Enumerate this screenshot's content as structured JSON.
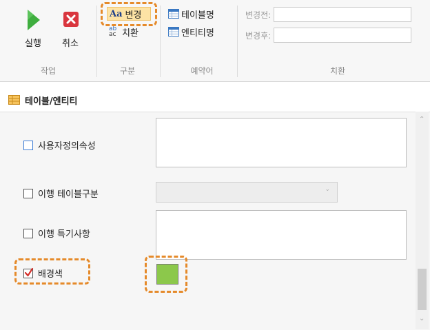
{
  "ribbon": {
    "run_label": "실행",
    "cancel_label": "취소",
    "change_label": "변경",
    "replace_label": "치환",
    "table_name_label": "테이블명",
    "entity_name_label": "엔티티명",
    "before_label": "변경전:",
    "after_label": "변경후:",
    "before_value": "",
    "after_value": "",
    "groups": {
      "work": "작업",
      "category": "구분",
      "reserved": "예약어",
      "replace": "치환"
    }
  },
  "panel": {
    "title": "테이블/엔티티",
    "properties": {
      "user_defined": "사용자정의속성",
      "migration_table_type": "이행 테이블구분",
      "migration_notes": "이행 특기사항",
      "background_color": "배경색"
    },
    "background_color_checked": true,
    "background_color_value": "#8cc84b"
  },
  "colors": {
    "highlight": "#e58a2a",
    "run_icon": "#3fae3f",
    "cancel_icon": "#d9363e"
  },
  "icons": {
    "run": "play-icon",
    "cancel": "close-icon",
    "change": "text-aa-icon",
    "replace": "replace-abc-icon",
    "table": "table-icon",
    "entity": "table-icon",
    "panel": "table-grid-icon"
  }
}
